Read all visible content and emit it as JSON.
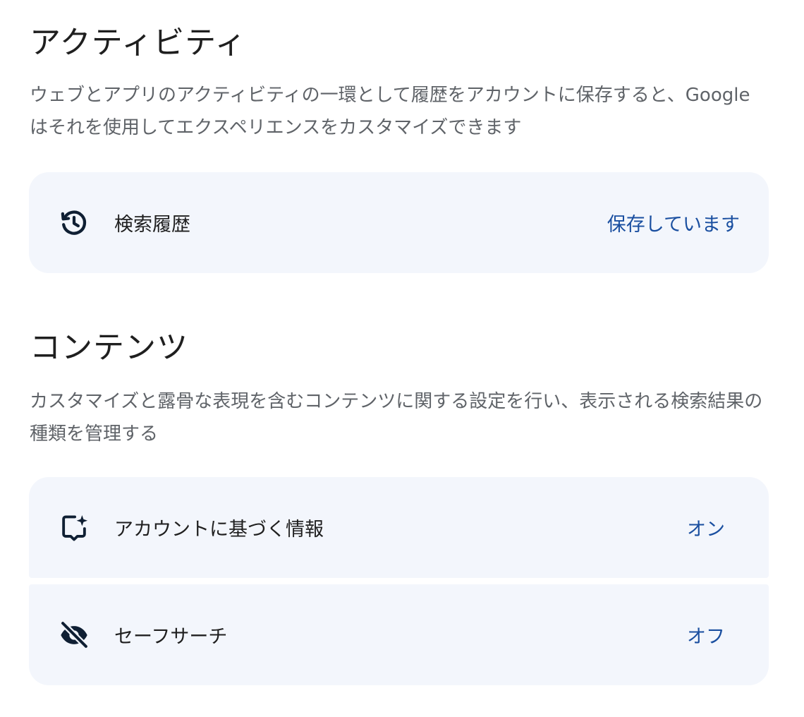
{
  "activity": {
    "title": "アクティビティ",
    "description": "ウェブとアプリのアクティビティの一環として履歴をアカウントに保存すると、Google はそれを使用してエクスペリエンスをカスタマイズできます",
    "items": [
      {
        "icon": "history-icon",
        "label": "検索履歴",
        "value": "保存しています"
      }
    ]
  },
  "content": {
    "title": "コンテンツ",
    "description": "カスタマイズと露骨な表現を含むコンテンツに関する設定を行い、表示される検索結果の種類を管理する",
    "items": [
      {
        "icon": "sparkle-chat-icon",
        "label": "アカウントに基づく情報",
        "value": "オン"
      },
      {
        "icon": "visibility-off-icon",
        "label": "セーフサーチ",
        "value": "オフ"
      }
    ]
  },
  "colors": {
    "card_background": "#f3f6fc",
    "value_text": "#1a4fa0",
    "icon": "#0f1f33"
  }
}
